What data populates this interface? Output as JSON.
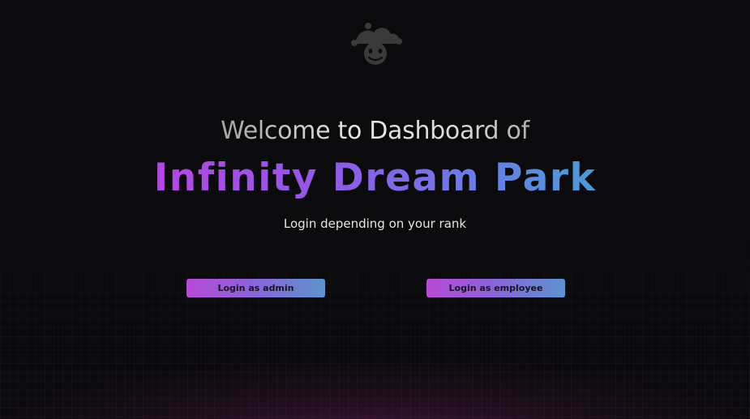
{
  "logo": {
    "icon": "jester-hat-icon",
    "color": "#3a3a3a"
  },
  "header": {
    "welcome": "Welcome to Dashboard of",
    "park_name": "Infinity Dream Park",
    "subtitle": "Login depending on your rank"
  },
  "actions": {
    "admin_label": "Login as admin",
    "employee_label": "Login as employee"
  },
  "colors": {
    "background": "#0b0a0c",
    "accent_start": "#b84bd6",
    "accent_end": "#5b93cf"
  }
}
